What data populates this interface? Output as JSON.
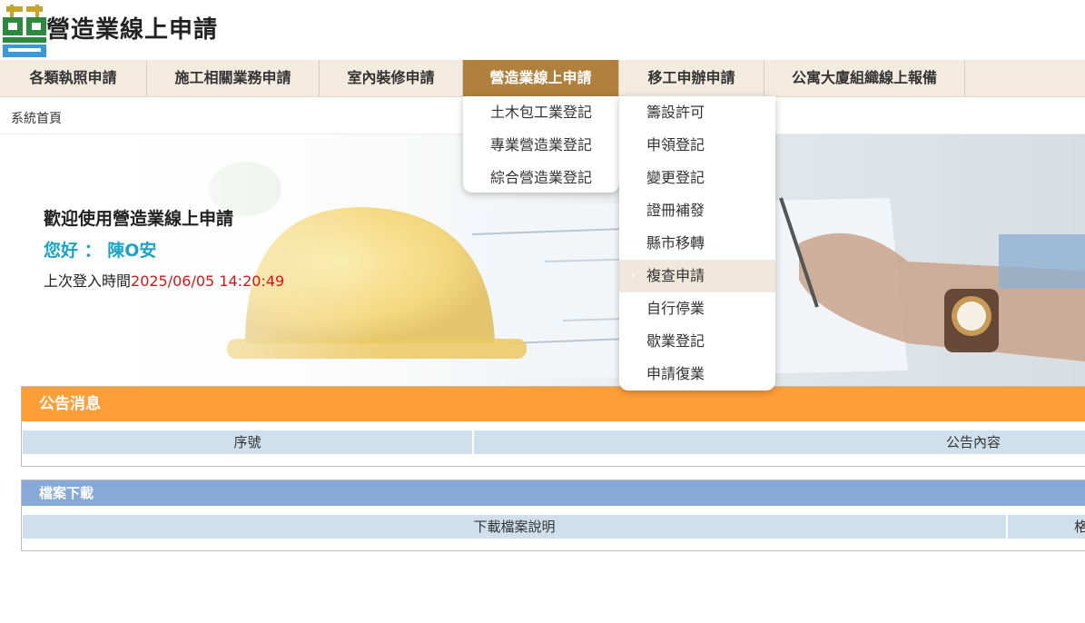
{
  "header": {
    "site_title": "營造業線上申請"
  },
  "nav": {
    "items": [
      {
        "label": "各類執照申請"
      },
      {
        "label": "施工相關業務申請"
      },
      {
        "label": "室內裝修申請"
      },
      {
        "label": "營造業線上申請"
      },
      {
        "label": "移工申辦申請"
      },
      {
        "label": "公寓大廈組織線上報備"
      }
    ],
    "active_index": 3
  },
  "dropdown_main": {
    "items": [
      "土木包工業登記",
      "專業營造業登記",
      "綜合營造業登記"
    ]
  },
  "dropdown_sub": {
    "items": [
      "籌設許可",
      "申領登記",
      "變更登記",
      "證冊補發",
      "縣市移轉",
      "複查申請",
      "自行停業",
      "歇業登記",
      "申請復業"
    ],
    "hover_index": 5
  },
  "breadcrumb": "系統首頁",
  "welcome": {
    "title": "歡迎使用營造業線上申請",
    "greeting": "您好 ： 陳O安",
    "last_login_label": "上次登入時間",
    "last_login_time": "2025/06/05 14:20:49"
  },
  "announcements": {
    "title": "公告消息",
    "columns": [
      "序號",
      "公告內容"
    ]
  },
  "downloads": {
    "title": "檔案下載",
    "columns": [
      "下載檔案說明",
      "格"
    ]
  },
  "colors": {
    "nav_active": "#b0803c",
    "announce_header": "#fe9e37",
    "download_header": "#86a9d8",
    "greeting": "#1aa3c6",
    "login_time": "#d01818"
  }
}
